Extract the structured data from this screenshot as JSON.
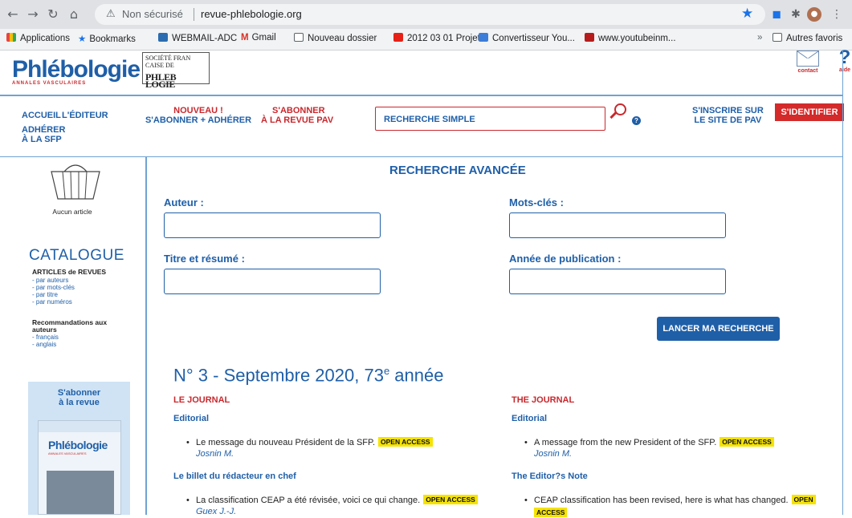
{
  "browser": {
    "security_label": "Non sécurisé",
    "url": "revue-phlebologie.org",
    "bookmarks": [
      {
        "label": "Applications",
        "icon": "apps-grid-icon",
        "color": "#e8453c"
      },
      {
        "label": "Bookmarks",
        "icon": "star-icon",
        "color": "#1a73e8"
      },
      {
        "label": "WEBMAIL-ADC",
        "icon": "outlook-icon",
        "color": "#2b6cb0"
      },
      {
        "label": "Gmail",
        "icon": "gmail-icon",
        "color": "#d93025"
      },
      {
        "label": "Nouveau dossier",
        "icon": "folder-icon",
        "color": "#5f6368"
      },
      {
        "label": "2012 03 01 Projet...",
        "icon": "youtube-icon",
        "color": "#e62117"
      },
      {
        "label": "Convertisseur You...",
        "icon": "converter-icon",
        "color": "#3b7dd8"
      },
      {
        "label": "www.youtubeinm...",
        "icon": "red-square-icon",
        "color": "#b71c1c"
      }
    ],
    "more_bookmarks": "»",
    "other_bookmarks": "Autres favoris"
  },
  "header": {
    "logo_text": "Phlébologie",
    "logo_subtitle": "ANNALES VASCULAIRES",
    "sfp_logo_line1": "SOCIÉTÉ FRAN  CAISE DE",
    "sfp_logo_line2": "PHLEB  LOGIE",
    "contact_label": "contact",
    "help_label": "aide",
    "help_glyph": "?"
  },
  "nav": {
    "home": "ACCUEIL",
    "editor": "L'ÉDITEUR",
    "join_line1": "ADHÉRER",
    "join_line2": "À LA SFP",
    "new_line1": "NOUVEAU !",
    "new_line2": "S'ABONNER + ADHÉRER",
    "subscribe_line1": "S'ABONNER",
    "subscribe_line2": "À LA REVUE PAV",
    "search_placeholder": "RECHERCHE SIMPLE",
    "help_dot": "?",
    "register_line1": "S'INSCRIRE SUR",
    "register_line2": "LE SITE DE PAV",
    "login": "S'IDENTIFIER"
  },
  "sidebar": {
    "cart_empty": "Aucun article",
    "catalogue_title": "CATALOGUE",
    "articles_heading": "ARTICLES de REVUES",
    "articles_links": [
      "- par auteurs",
      "- par mots-clés",
      "- par titre",
      "- par numéros"
    ],
    "recommendations_heading_line1": "Recommandations aux",
    "recommendations_heading_line2": "auteurs",
    "recommendations_links": [
      "- français",
      "- anglais"
    ],
    "subscribe_line1": "S'abonner",
    "subscribe_line2": "à la revue",
    "cover_title": "Phlébologie",
    "cover_subtitle": "ANNALES VASCULAIRES"
  },
  "search_form": {
    "title": "RECHERCHE AVANCÉE",
    "author_label": "Auteur :",
    "keywords_label": "Mots-clés :",
    "title_label": "Titre et résumé :",
    "year_label": "Année de publication :",
    "submit": "LANCER MA RECHERCHE"
  },
  "issue": {
    "title_main": "N° 3 - Septembre 2020, 73",
    "title_sup": "e",
    "title_end": " année",
    "fr": {
      "heading": "LE JOURNAL",
      "section1": "Editorial",
      "article1": "Le message du nouveau Président de la SFP.",
      "author1": "Josnin M.",
      "section2": "Le billet du rédacteur en chef",
      "article2": "La classification CEAP a été révisée, voici ce qui change.",
      "author2": "Guex J.-J."
    },
    "en": {
      "heading": "THE JOURNAL",
      "section1": "Editorial",
      "article1": "A message from the new President of the SFP.",
      "author1": "Josnin M.",
      "section2": "The Editor?s Note",
      "article2": "CEAP classification has been revised, here is what has changed.",
      "oa_line1": "OPEN",
      "oa_line2": "ACCESS"
    },
    "open_access_label": "OPEN ACCESS"
  }
}
